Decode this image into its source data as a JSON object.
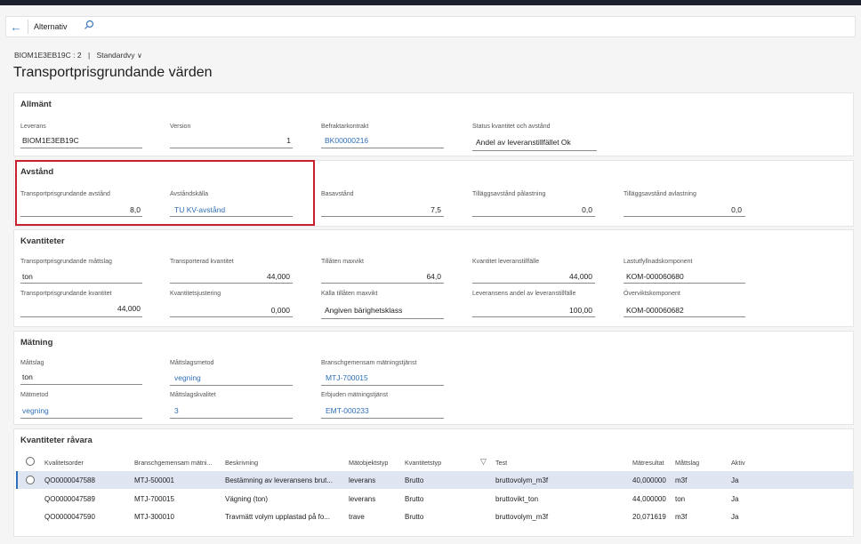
{
  "actionbar": {
    "label": "Alternativ"
  },
  "breadcrumb": {
    "record": "BIOM1E3EB19C : 2",
    "separator": "|",
    "view": "Standardvy"
  },
  "page": {
    "title": "Transportprisgrundande värden"
  },
  "allmant": {
    "title": "Allmänt",
    "leverans_label": "Leverans",
    "leverans_value": "BIOM1E3EB19C",
    "version_label": "Version",
    "version_value": "1",
    "kontrakt_label": "Befraktarkontrakt",
    "kontrakt_value": "BK00000216",
    "status_label": "Status kvantitet och avstånd",
    "status_value": "Andel av leveranstillfället Ok"
  },
  "avstand": {
    "title": "Avstånd",
    "tp_avstand_label": "Transportprisgrundande avstånd",
    "tp_avstand_value": "8,0",
    "kalla_label": "Avståndskälla",
    "kalla_value": "TU KV-avstånd",
    "bas_label": "Basavstånd",
    "bas_value": "7,5",
    "pa_label": "Tilläggsavstånd pålastning",
    "pa_value": "0,0",
    "av_label": "Tilläggsavstånd avlastning",
    "av_value": "0,0"
  },
  "kvantiteter": {
    "title": "Kvantiteter",
    "mattslag_label": "Transportprisgrundande måttslag",
    "mattslag_value": "ton",
    "transporterad_label": "Transporterad kvantitet",
    "transporterad_value": "44,000",
    "maxvikt_label": "Tillåten maxvikt",
    "maxvikt_value": "64,0",
    "kv_lev_label": "Kvantitet leveranstillfälle",
    "kv_lev_value": "44,000",
    "lastut_label": "Lastutfyllnadskomponent",
    "lastut_value": "KOM-000060680",
    "tp_kvant_label": "Transportprisgrundande kvantitet",
    "tp_kvant_value": "44,000",
    "justering_label": "Kvantitetsjustering",
    "justering_value": "0,000",
    "kalla_max_label": "Källa tillåten maxvikt",
    "kalla_max_value": "Angiven bärighetsklass",
    "andel_label": "Leveransens andel av leveranstillfälle",
    "andel_value": "100,00",
    "overvikt_label": "Överviktskomponent",
    "overvikt_value": "KOM-000060682"
  },
  "matning": {
    "title": "Mätning",
    "mattslag_label": "Måttslag",
    "mattslag_value": "ton",
    "metod_label": "Måttslagsmetod",
    "metod_value": "vegning",
    "bransch_label": "Branschgemensam mätningstjänst",
    "bransch_value": "MTJ-700015",
    "matmetod_label": "Mätmetod",
    "matmetod_value": "vegning",
    "kvalitet_label": "Måttslagskvalitet",
    "kvalitet_value": "3",
    "erbjuden_label": "Erbjuden mätningstjänst",
    "erbjuden_value": "EMT-000233"
  },
  "ravara": {
    "title": "Kvantiteter råvara",
    "headers": [
      "Kvalitetsorder",
      "Branschgemensam mätni...",
      "Beskrivning",
      "Mätobjektstyp",
      "Kvantitetstyp",
      "Test",
      "Mätresultat",
      "Måttslag",
      "Aktiv"
    ],
    "rows": [
      [
        "QO0000047588",
        "MTJ-500001",
        "Bestämning av leveransens brut...",
        "leverans",
        "Brutto",
        "bruttovolym_m3f",
        "40,000000",
        "m3f",
        "Ja"
      ],
      [
        "QO0000047589",
        "MTJ-700015",
        "Vägning (ton)",
        "leverans",
        "Brutto",
        "bruttovikt_ton",
        "44,000000",
        "ton",
        "Ja"
      ],
      [
        "QO0000047590",
        "MTJ-300010",
        "Travmätt volym upplastad på fo...",
        "trave",
        "Brutto",
        "bruttovolym_m3f",
        "20,071619",
        "m3f",
        "Ja"
      ]
    ]
  },
  "colors": {
    "accent": "#2f6fb7",
    "highlight": "#c8202c",
    "selected_row": "#dfe6f2"
  },
  "icons": [
    "back-arrow-icon",
    "search-icon",
    "chevron-down-icon",
    "filter-icon",
    "radio-icon"
  ]
}
